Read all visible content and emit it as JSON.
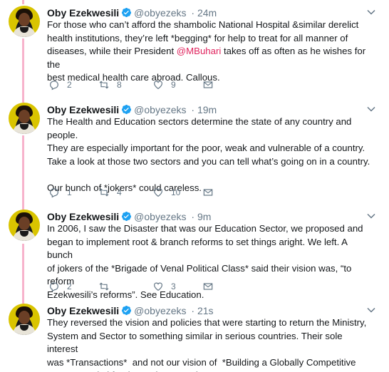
{
  "colors": {
    "thread_line": "#f7b3cc",
    "mention": "#e0245e",
    "verified": "#1da1f2",
    "muted": "#657786"
  },
  "icons": {
    "reply": "reply-icon",
    "retweet": "retweet-icon",
    "like": "heart-icon",
    "dm": "envelope-icon",
    "verified": "verified-badge-icon",
    "menu": "chevron-down-icon"
  },
  "tweets": [
    {
      "name": "Oby Ezekwesili",
      "handle": "@obyezeks",
      "time": "· 24m",
      "text_before": "For those who can’t afford the shambolic National Hospital &similar derelict\nhealth institutions, they’re left *begging* for help to treat for all manner of\ndiseases, while their President ",
      "mention": "@MBuhari",
      "text_after": " takes off as often as he wishes for the\nbest medical health care abroad. Callous.",
      "replies": "2",
      "retweets": "8",
      "likes": "9"
    },
    {
      "name": "Oby Ezekwesili",
      "handle": "@obyezeks",
      "time": "· 19m",
      "text": "The Health and Education sectors determine the state of any country and people.\nThey are especially important for the poor, weak and vulnerable of a country.\nTake a look at those two sectors and you can tell what’s going on in a country.\n\nOur bunch of *jokers* could careless.",
      "replies": "1",
      "retweets": "4",
      "likes": "10"
    },
    {
      "name": "Oby Ezekwesili",
      "handle": "@obyezeks",
      "time": "· 9m",
      "text": "In 2006, I saw the Disaster that was our Education Sector, we proposed and\nbegan to implement root & branch reforms to set things aright. We left. A bunch\nof jokers of the *Brigade of Venal Political Class* said their vision was, “to reform\nEzekwesili’s reforms”. See Education.",
      "replies": "2",
      "retweets": "",
      "likes": "3"
    },
    {
      "name": "Oby Ezekwesili",
      "handle": "@obyezeks",
      "time": "· 21s",
      "text": "They reversed the vision and policies that were starting to return the Ministry,\nSystem and Sector to something similar in serious countries. Their sole interest\nwas *Transactions*  and not our vision of  *Building a Globally Competitive\nHuman Capital for the Nation*. Tragic."
    }
  ]
}
